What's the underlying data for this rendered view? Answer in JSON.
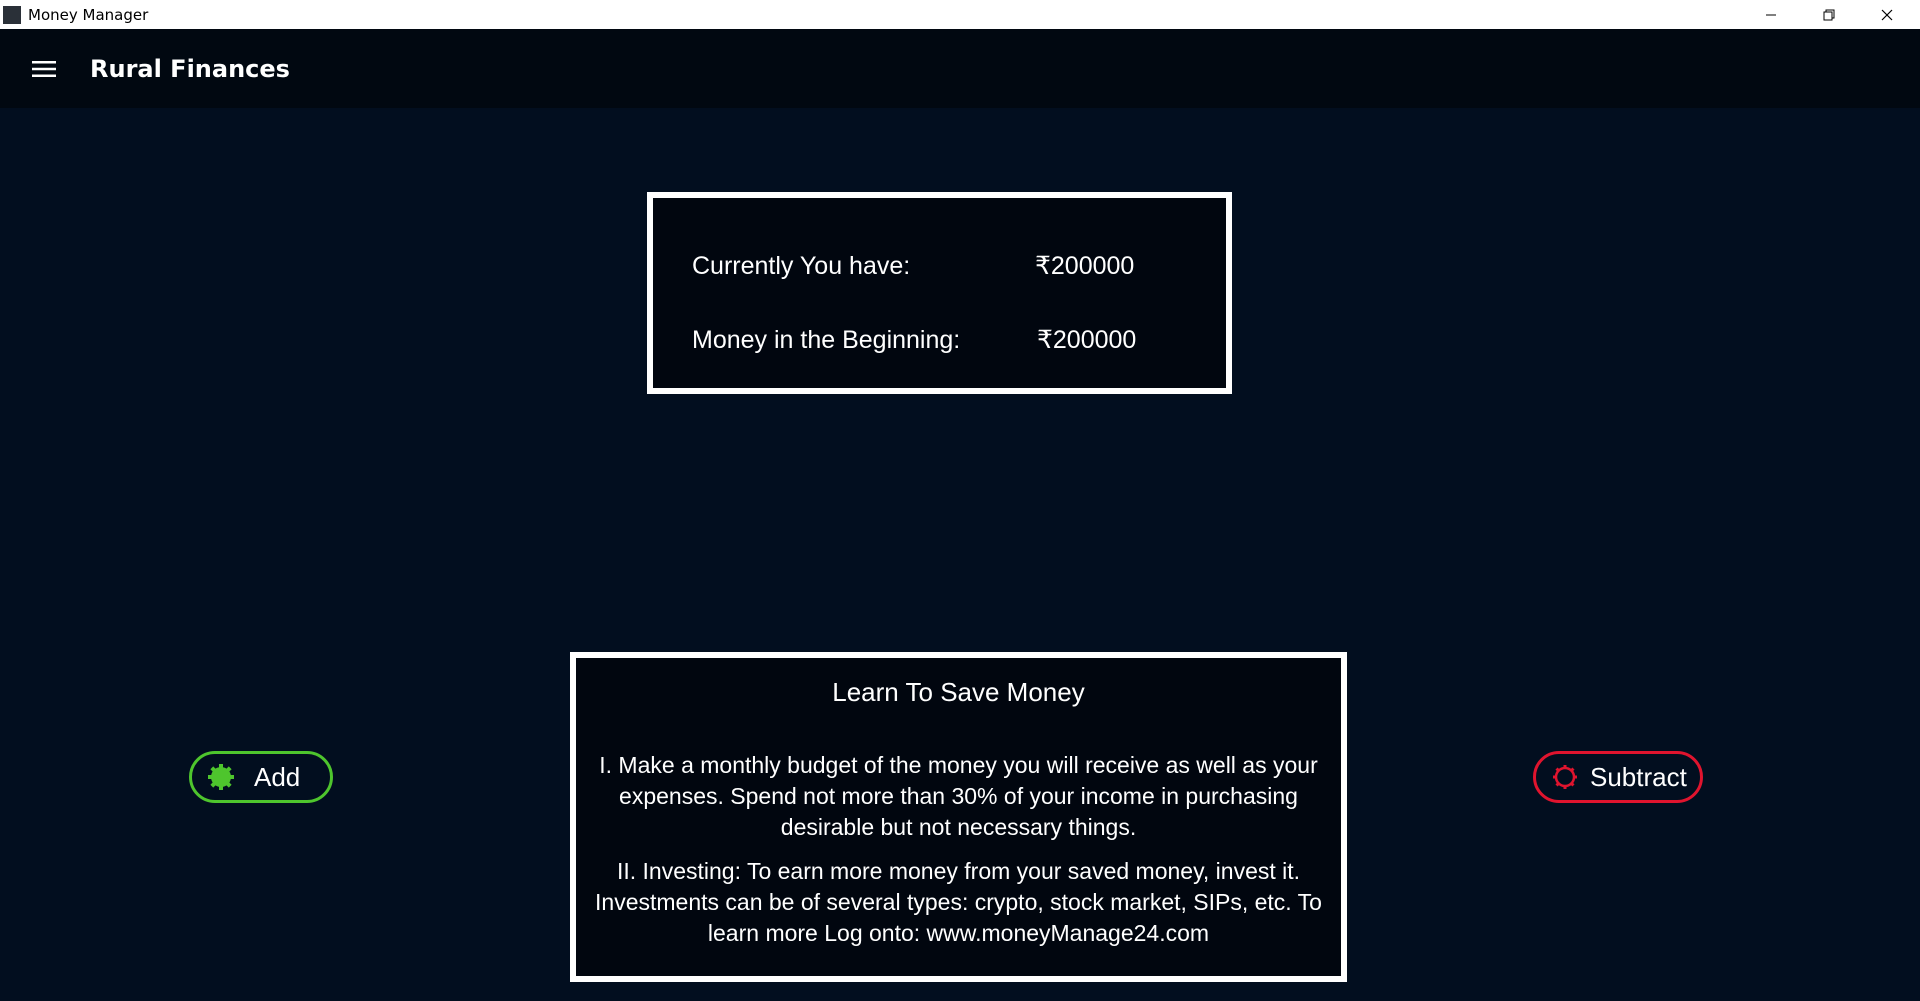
{
  "window": {
    "title": "Money Manager"
  },
  "appbar": {
    "title": "Rural Finances",
    "menu_icon": "hamburger-menu-icon"
  },
  "balance": {
    "current_label": "Currently You have:",
    "current_value": "₹200000",
    "beginning_label": "Money in the Beginning:",
    "beginning_value": "₹200000"
  },
  "tips": {
    "title": "Learn To Save Money",
    "items": [
      "I. Make a monthly budget of the money you will receive as well as your expenses. Spend not more than 30% of your income in purchasing desirable but not necessary things.",
      "II. Investing: To earn more money from your saved money, invest it. Investments can be of several types: crypto, stock market, SIPs, etc. To learn more Log onto: www.moneyManage24.com"
    ]
  },
  "actions": {
    "add_label": "Add",
    "add_icon": "add-gear-icon",
    "add_color": "#4ec52d",
    "subtract_label": "Subtract",
    "subtract_icon": "subtract-gear-icon",
    "subtract_color": "#e0142e"
  },
  "colors": {
    "background": "#020e1f",
    "appbar": "#010811",
    "panel": "#01060f",
    "panel_border": "#ffffff"
  }
}
